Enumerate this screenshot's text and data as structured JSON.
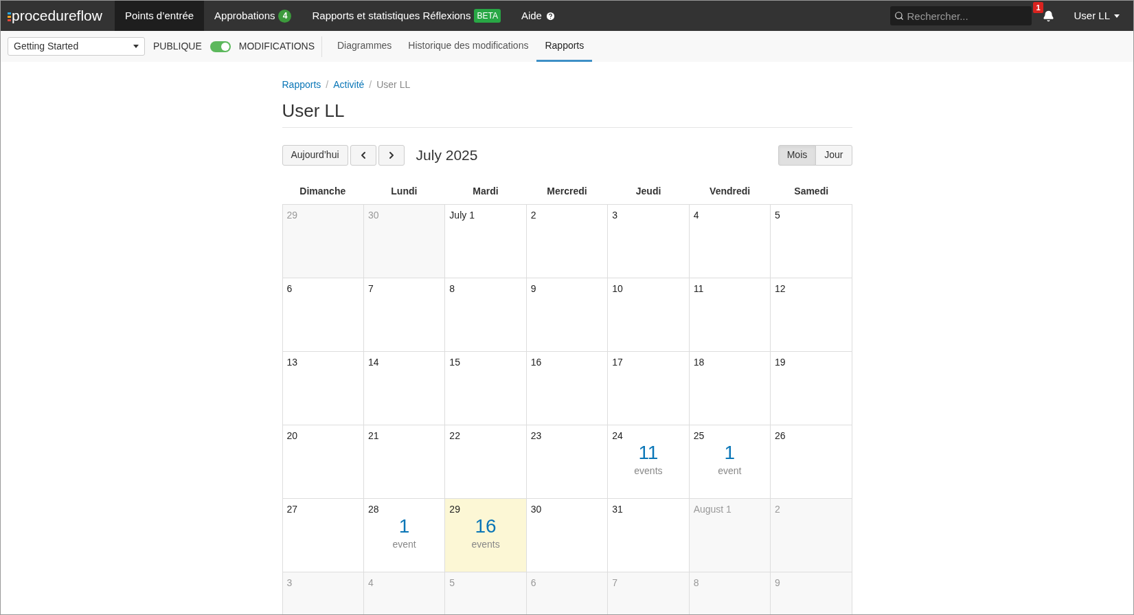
{
  "topbar": {
    "logo": "procedureflow",
    "nav": [
      {
        "label": "Points d’entrée",
        "selected": true
      },
      {
        "label": "Approbations",
        "badge": "4",
        "selected": false
      },
      {
        "label": "Rapports et statistiques Réflexions",
        "tag": "BETA",
        "selected": false
      },
      {
        "label": "Aide",
        "help": true,
        "selected": false
      }
    ],
    "search": {
      "placeholder": "Rechercher..."
    },
    "notifications": "1",
    "user": "User LL"
  },
  "toolbar": {
    "dropdown": "Getting Started",
    "left_label": "PUBLIQUE",
    "toggle_on": true,
    "right_label": "MODIFICATIONS",
    "tabs": [
      {
        "label": "Diagrammes",
        "selected": false
      },
      {
        "label": "Historique des modifications",
        "selected": false
      },
      {
        "label": "Rapports",
        "selected": true
      }
    ]
  },
  "breadcrumb": {
    "separator": "/",
    "items": [
      {
        "label": "Rapports",
        "link": true
      },
      {
        "label": "Activité",
        "link": true
      },
      {
        "label": "User LL",
        "link": false
      }
    ]
  },
  "title": "User LL",
  "calendar": {
    "today_button": "Aujourd’hui",
    "month": "July 2025",
    "views": [
      {
        "label": "Mois",
        "selected": true
      },
      {
        "label": "Jour",
        "selected": false
      }
    ],
    "weekdays": [
      "Dimanche",
      "Lundi",
      "Mardi",
      "Mercredi",
      "Jeudi",
      "Vendredi",
      "Samedi"
    ],
    "weeks": [
      [
        {
          "label": "29",
          "other_month": true,
          "today": false
        },
        {
          "label": "30",
          "other_month": true,
          "today": false
        },
        {
          "label": "July 1",
          "other_month": false,
          "today": false
        },
        {
          "label": "2",
          "other_month": false,
          "today": false
        },
        {
          "label": "3",
          "other_month": false,
          "today": false
        },
        {
          "label": "4",
          "other_month": false,
          "today": false
        },
        {
          "label": "5",
          "other_month": false,
          "today": false
        }
      ],
      [
        {
          "label": "6",
          "other_month": false,
          "today": false
        },
        {
          "label": "7",
          "other_month": false,
          "today": false
        },
        {
          "label": "8",
          "other_month": false,
          "today": false
        },
        {
          "label": "9",
          "other_month": false,
          "today": false
        },
        {
          "label": "10",
          "other_month": false,
          "today": false
        },
        {
          "label": "11",
          "other_month": false,
          "today": false
        },
        {
          "label": "12",
          "other_month": false,
          "today": false
        }
      ],
      [
        {
          "label": "13",
          "other_month": false,
          "today": false
        },
        {
          "label": "14",
          "other_month": false,
          "today": false
        },
        {
          "label": "15",
          "other_month": false,
          "today": false
        },
        {
          "label": "16",
          "other_month": false,
          "today": false
        },
        {
          "label": "17",
          "other_month": false,
          "today": false
        },
        {
          "label": "18",
          "other_month": false,
          "today": false
        },
        {
          "label": "19",
          "other_month": false,
          "today": false
        }
      ],
      [
        {
          "label": "20",
          "other_month": false,
          "today": false
        },
        {
          "label": "21",
          "other_month": false,
          "today": false
        },
        {
          "label": "22",
          "other_month": false,
          "today": false
        },
        {
          "label": "23",
          "other_month": false,
          "today": false
        },
        {
          "label": "24",
          "other_month": false,
          "today": false,
          "count": "11",
          "unit": "events"
        },
        {
          "label": "25",
          "other_month": false,
          "today": false,
          "count": "1",
          "unit": "event"
        },
        {
          "label": "26",
          "other_month": false,
          "today": false
        }
      ],
      [
        {
          "label": "27",
          "other_month": false,
          "today": false
        },
        {
          "label": "28",
          "other_month": false,
          "today": false,
          "count": "1",
          "unit": "event"
        },
        {
          "label": "29",
          "other_month": false,
          "today": true,
          "count": "16",
          "unit": "events"
        },
        {
          "label": "30",
          "other_month": false,
          "today": false
        },
        {
          "label": "31",
          "other_month": false,
          "today": false
        },
        {
          "label": "August 1",
          "other_month": true,
          "today": false
        },
        {
          "label": "2",
          "other_month": true,
          "today": false
        }
      ],
      [
        {
          "label": "3",
          "other_month": true,
          "today": false
        },
        {
          "label": "4",
          "other_month": true,
          "today": false
        },
        {
          "label": "5",
          "other_month": true,
          "today": false
        },
        {
          "label": "6",
          "other_month": true,
          "today": false
        },
        {
          "label": "7",
          "other_month": true,
          "today": false
        },
        {
          "label": "8",
          "other_month": true,
          "today": false
        },
        {
          "label": "9",
          "other_month": true,
          "today": false
        }
      ]
    ]
  }
}
